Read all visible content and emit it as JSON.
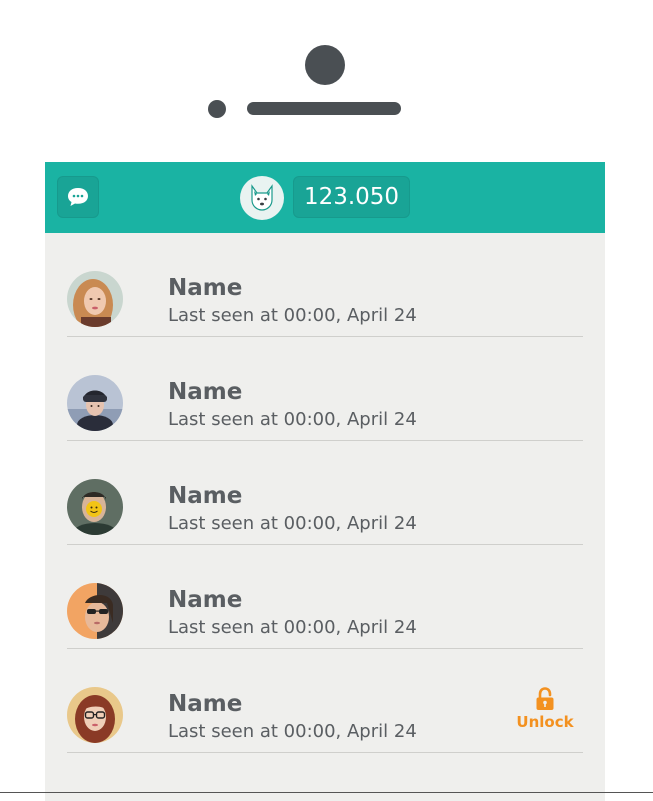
{
  "header": {
    "chat_icon": "chat-bubble-icon",
    "mascot_icon": "husky-icon",
    "coins": "123.050"
  },
  "contacts": [
    {
      "name": "Name",
      "last_seen": "Last seen at 00:00, April 24",
      "avatar": "woman-blonde-avatar",
      "locked": false
    },
    {
      "name": "Name",
      "last_seen": "Last seen at 00:00, April 24",
      "avatar": "woman-beanie-avatar",
      "locked": false
    },
    {
      "name": "Name",
      "last_seen": "Last seen at 00:00, April 24",
      "avatar": "man-smiley-ball-avatar",
      "locked": false
    },
    {
      "name": "Name",
      "last_seen": "Last seen at 00:00, April 24",
      "avatar": "woman-sunglasses-avatar",
      "locked": false
    },
    {
      "name": "Name",
      "last_seen": "Last seen at 00:00, April 24",
      "avatar": "woman-glasses-avatar",
      "locked": true,
      "unlock_label": "Unlock"
    }
  ],
  "colors": {
    "accent": "#1ab3a3",
    "unlock": "#f39120",
    "text": "#5a5e62",
    "device": "#4a4f53"
  }
}
